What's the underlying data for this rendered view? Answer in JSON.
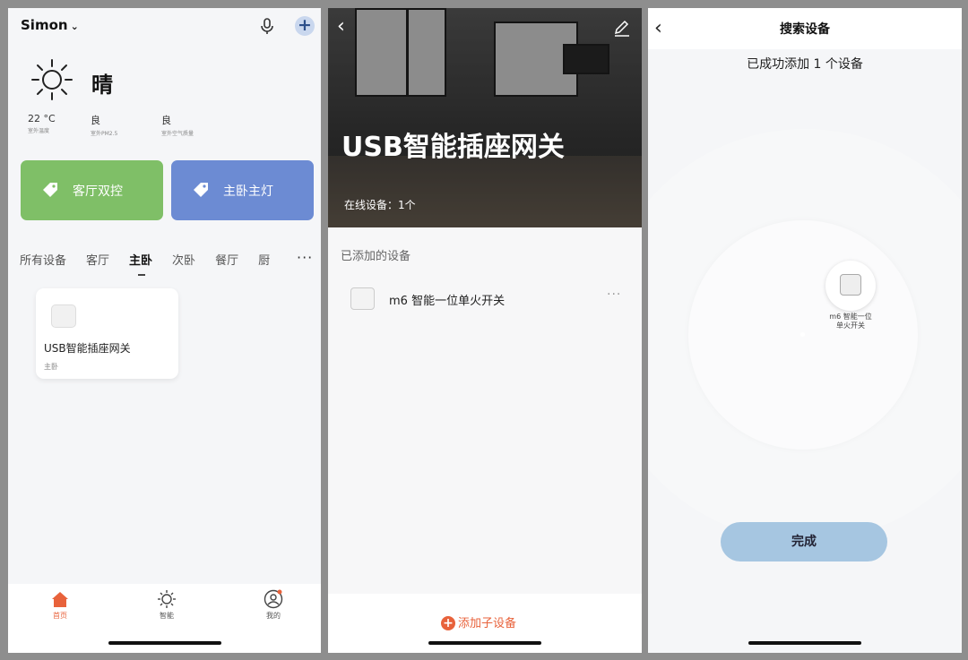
{
  "home": {
    "user": "Simon",
    "weather": "晴",
    "stats": [
      {
        "value": "22 °C",
        "caption": "室外温度"
      },
      {
        "value": "良",
        "caption": "室外PM2.5"
      },
      {
        "value": "良",
        "caption": "室外空气质量"
      }
    ],
    "scenes": [
      {
        "label": "客厅双控",
        "color": "#7fbf67"
      },
      {
        "label": "主卧主灯",
        "color": "#6c8bd3"
      }
    ],
    "rooms": [
      "所有设备",
      "客厅",
      "主卧",
      "次卧",
      "餐厅",
      "厨"
    ],
    "active_room": "主卧",
    "more": "···",
    "device_card": {
      "name": "USB智能插座网关",
      "room": "主卧"
    },
    "tabbar": [
      {
        "label": "首页",
        "icon": "home-icon",
        "active": true
      },
      {
        "label": "智能",
        "icon": "sun-icon",
        "active": false
      },
      {
        "label": "我的",
        "icon": "profile-icon",
        "active": false
      }
    ],
    "accent": "#e8623b"
  },
  "gateway": {
    "title": "USB智能插座网关",
    "online": "在线设备：1个",
    "section": "已添加的设备",
    "device_name": "m6 智能一位单火开关",
    "dots": "···",
    "add_sub": "添加子设备"
  },
  "search": {
    "title": "搜索设备",
    "message": "已成功添加 1 个设备",
    "found_line1": "m6 智能一位",
    "found_line2": "单火开关",
    "done": "完成"
  }
}
